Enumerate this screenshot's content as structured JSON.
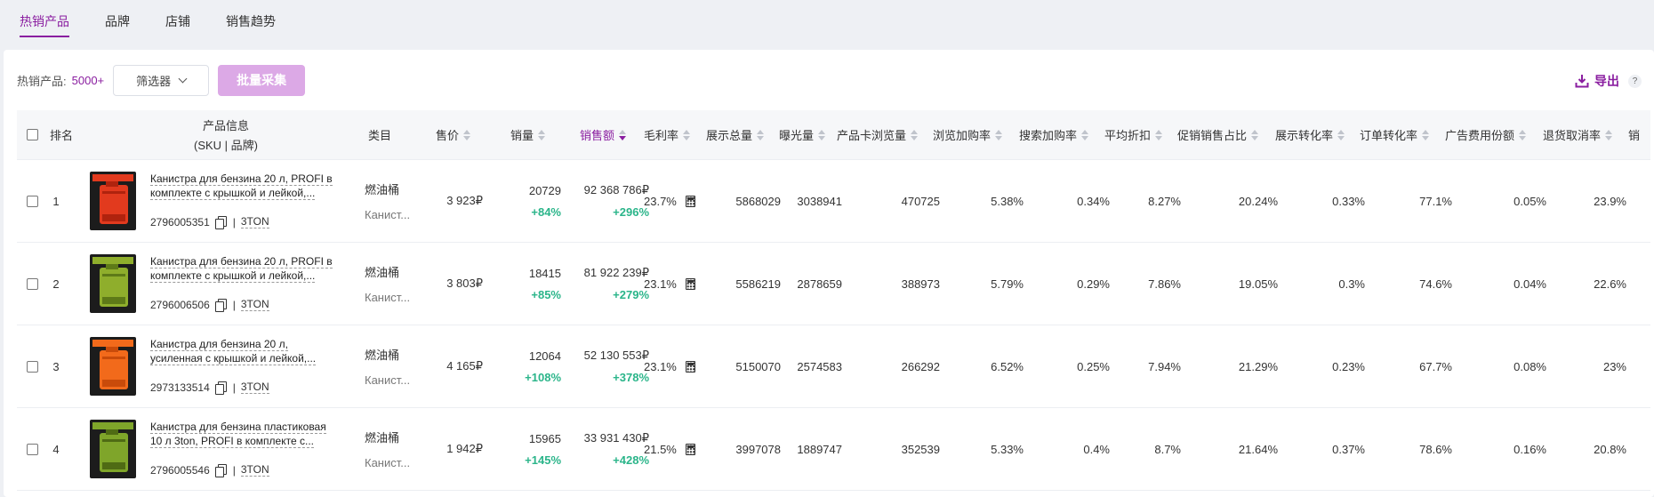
{
  "tabs": [
    {
      "label": "热销产品",
      "active": true
    },
    {
      "label": "品牌",
      "active": false
    },
    {
      "label": "店铺",
      "active": false
    },
    {
      "label": "销售趋势",
      "active": false
    }
  ],
  "toolbar": {
    "hot_label": "热销产品:",
    "hot_count": "5000+",
    "filter_label": "筛选器",
    "batch_label": "批量采集",
    "export_label": "导出",
    "help": "?"
  },
  "columns": {
    "rank": "排名",
    "product_info": "产品信息",
    "product_sub": "(SKU | 品牌)",
    "category": "类目",
    "price": "售价",
    "sales": "销量",
    "revenue": "销售额",
    "margin": "毛利率",
    "impressions": "展示总量",
    "exposure": "曝光量",
    "card_views": "产品卡浏览量",
    "view_to_cart": "浏览加购率",
    "search_to_cart": "搜索加购率",
    "avg_discount": "平均折扣",
    "promo_share": "促销销售占比",
    "show_conv": "展示转化率",
    "order_conv": "订单转化率",
    "ad_share": "广告费用份额",
    "return_rate": "退货取消率",
    "more": "销"
  },
  "rows": [
    {
      "rank": "1",
      "name": "Канистра для бензина 20 л, PROFI в комплекте с крышкой и лейкой,...",
      "sku": "2796005351",
      "sep": "|",
      "brand": "3TON",
      "cat": "燃油桶",
      "cat_sub": "Канист...",
      "price": "3 923₽",
      "sales": "20729",
      "sales_growth": "+84%",
      "revenue": "92 368 786₽",
      "revenue_growth": "+296%",
      "margin": "23.7%",
      "impressions": "5868029",
      "exposure": "3038941",
      "card_views": "470725",
      "view_to_cart": "5.38%",
      "search_to_cart": "0.34%",
      "avg_discount": "8.27%",
      "promo_share": "20.24%",
      "show_conv": "0.33%",
      "order_conv": "77.1%",
      "ad_share": "0.05%",
      "return_rate": "23.9%",
      "thumb": "red-canister"
    },
    {
      "rank": "2",
      "name": "Канистра для бензина 20 л, PROFI в комплекте с крышкой и лейкой,...",
      "sku": "2796006506",
      "sep": "|",
      "brand": "3TON",
      "cat": "燃油桶",
      "cat_sub": "Канист...",
      "price": "3 803₽",
      "sales": "18415",
      "sales_growth": "+85%",
      "revenue": "81 922 239₽",
      "revenue_growth": "+279%",
      "margin": "23.1%",
      "impressions": "5586219",
      "exposure": "2878659",
      "card_views": "388973",
      "view_to_cart": "5.79%",
      "search_to_cart": "0.29%",
      "avg_discount": "7.86%",
      "promo_share": "19.05%",
      "show_conv": "0.3%",
      "order_conv": "74.6%",
      "ad_share": "0.04%",
      "return_rate": "22.6%",
      "thumb": "green-canister"
    },
    {
      "rank": "3",
      "name": "Канистра для бензина 20 л, усиленная с крышкой и лейкой,...",
      "sku": "2973133514",
      "sep": "|",
      "brand": "3TON",
      "cat": "燃油桶",
      "cat_sub": "Канист...",
      "price": "4 165₽",
      "sales": "12064",
      "sales_growth": "+108%",
      "revenue": "52 130 553₽",
      "revenue_growth": "+378%",
      "margin": "23.1%",
      "impressions": "5150070",
      "exposure": "2574583",
      "card_views": "266292",
      "view_to_cart": "6.52%",
      "search_to_cart": "0.25%",
      "avg_discount": "7.94%",
      "promo_share": "21.29%",
      "show_conv": "0.23%",
      "order_conv": "67.7%",
      "ad_share": "0.08%",
      "return_rate": "23%",
      "thumb": "orange-canister"
    },
    {
      "rank": "4",
      "name": "Канистра для бензина пластиковая 10 л 3ton, PROFI в комплекте с...",
      "sku": "2796005546",
      "sep": "|",
      "brand": "3TON",
      "cat": "燃油桶",
      "cat_sub": "Канист...",
      "price": "1 942₽",
      "sales": "15965",
      "sales_growth": "+145%",
      "revenue": "33 931 430₽",
      "revenue_growth": "+428%",
      "margin": "21.5%",
      "impressions": "3997078",
      "exposure": "1889747",
      "card_views": "352539",
      "view_to_cart": "5.33%",
      "search_to_cart": "0.4%",
      "avg_discount": "8.7%",
      "promo_share": "21.64%",
      "show_conv": "0.37%",
      "order_conv": "78.6%",
      "ad_share": "0.16%",
      "return_rate": "20.8%",
      "thumb": "green-canister-10l"
    }
  ],
  "colors": {
    "accent": "#8a1ea0",
    "positive": "#2bb58a",
    "batch_bg": "#dca9e6"
  }
}
